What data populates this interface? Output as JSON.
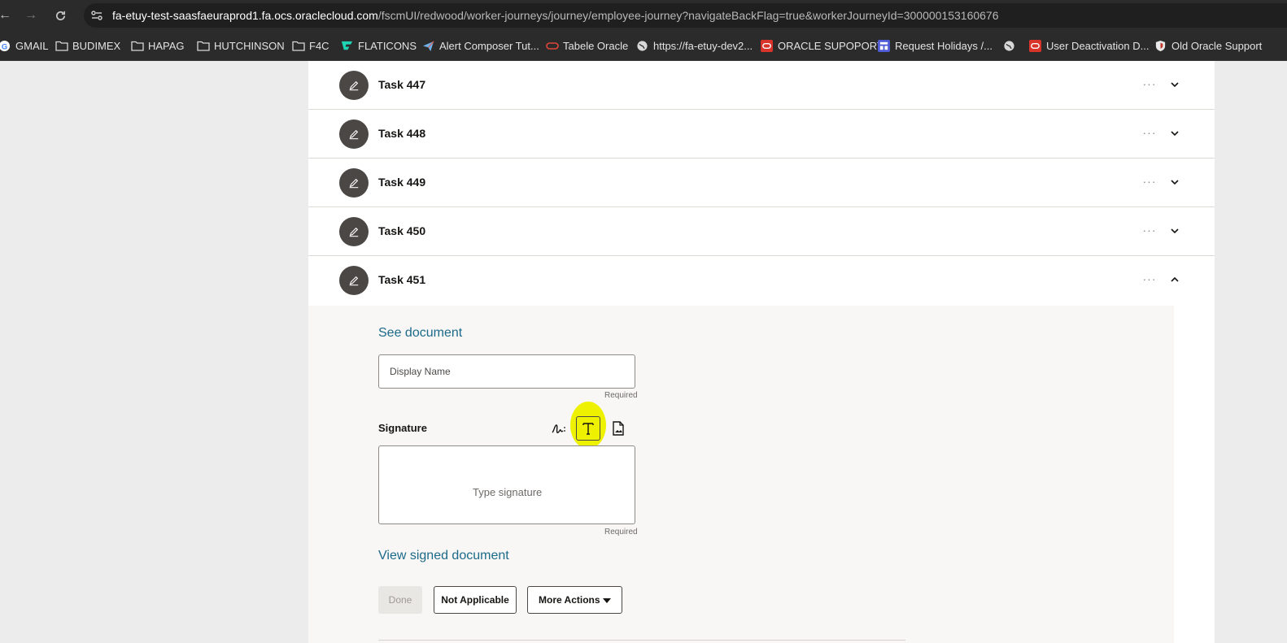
{
  "browser": {
    "url_host": "fa-etuy-test-saasfaeuraprod1.fa.ocs.oraclecloud.com",
    "url_path": "/fscmUI/redwood/worker-journeys/journey/employee-journey?navigateBackFlag=true&workerJourneyId=300000153160676",
    "bookmarks": [
      {
        "label": "GMAIL",
        "icon": "google-icon"
      },
      {
        "label": "BUDIMEX",
        "icon": "folder-icon"
      },
      {
        "label": "HAPAG",
        "icon": "folder-icon"
      },
      {
        "label": "HUTCHINSON",
        "icon": "folder-icon"
      },
      {
        "label": "F4C",
        "icon": "folder-icon"
      },
      {
        "label": "FLATICONS",
        "icon": "flaticon-icon"
      },
      {
        "label": "Alert Composer Tut...",
        "icon": "paper-plane-icon"
      },
      {
        "label": "Tabele Oracle",
        "icon": "oracle-icon"
      },
      {
        "label": "https://fa-etuy-dev2...",
        "icon": "globe-icon"
      },
      {
        "label": "ORACLE SUPOPORT",
        "icon": "oracle-red-icon"
      },
      {
        "label": "Request Holidays /...",
        "icon": "calendar-icon"
      },
      {
        "label": "",
        "icon": "globe-icon"
      },
      {
        "label": "User Deactivation D...",
        "icon": "oracle-red-icon"
      },
      {
        "label": "Old Oracle Support",
        "icon": "shield-icon"
      }
    ]
  },
  "tasks": [
    {
      "title": "Task 447"
    },
    {
      "title": "Task 448"
    },
    {
      "title": "Task 449"
    },
    {
      "title": "Task 450"
    },
    {
      "title": "Task 451"
    }
  ],
  "expanded_task": {
    "see_document": "See document",
    "display_name_placeholder": "Display Name",
    "display_name_required": "Required",
    "signature_label": "Signature",
    "signature_placeholder": "Type signature",
    "signature_required": "Required",
    "view_signed": "View signed document",
    "done_label": "Done",
    "not_applicable_label": "Not Applicable",
    "more_actions_label": "More Actions"
  },
  "colors": {
    "highlight": "#eef200",
    "link": "#1c6a89",
    "avatar": "#4b4744"
  }
}
